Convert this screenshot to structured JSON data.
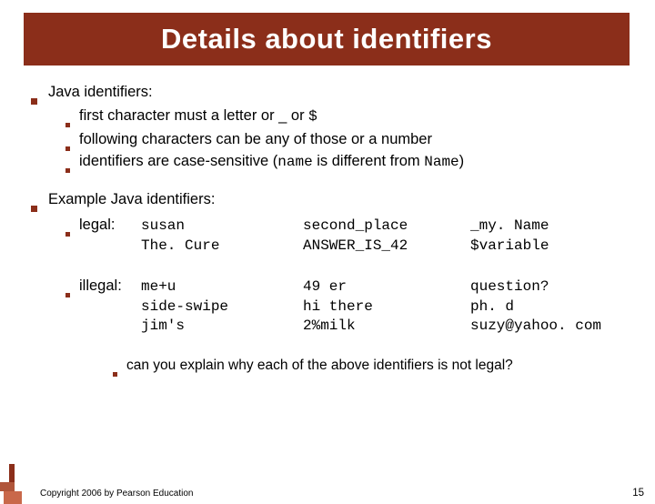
{
  "title": "Details about identifiers",
  "bullets": {
    "top": {
      "heading": "Java identifiers:",
      "items": [
        {
          "pre": "first character must a letter or _ or ",
          "mono": "$",
          "post": ""
        },
        {
          "pre": "following characters can be any of those or a number",
          "mono": "",
          "post": ""
        },
        {
          "pre": "identifiers are case-sensitive (",
          "mono": "name",
          "mid": " is different from ",
          "mono2": "Name",
          "post": ")"
        }
      ]
    },
    "examples_heading": "Example Java identifiers:",
    "legal": {
      "label": "legal:",
      "col1": "susan\nThe. Cure",
      "col2": "second_place\nANSWER_IS_42",
      "col3": "_my. Name\n$variable"
    },
    "illegal": {
      "label": "illegal:",
      "col1": "me+u\nside-swipe\njim's",
      "col2": "49 er\nhi there\n2%milk",
      "col3": "question?\nph. d\nsuzy@yahoo. com"
    },
    "question": "can you explain why each of the above identifiers is not legal?"
  },
  "footer": {
    "copyright": "Copyright 2006 by Pearson Education",
    "page": "15"
  }
}
